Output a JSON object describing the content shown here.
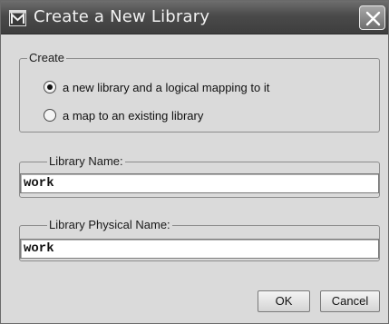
{
  "window": {
    "title": "Create a New Library"
  },
  "create_group": {
    "legend": "Create",
    "options": [
      {
        "label": "a new library and a logical mapping to it",
        "selected": true
      },
      {
        "label": "a map to an existing library",
        "selected": false
      }
    ]
  },
  "library_name": {
    "legend": "Library Name:",
    "value": "work"
  },
  "library_physical_name": {
    "legend": "Library Physical Name:",
    "value": "work"
  },
  "buttons": {
    "ok_label": "OK",
    "cancel_label": "Cancel"
  },
  "icons": {
    "app": "modelsim-m-icon",
    "close": "close-icon"
  }
}
